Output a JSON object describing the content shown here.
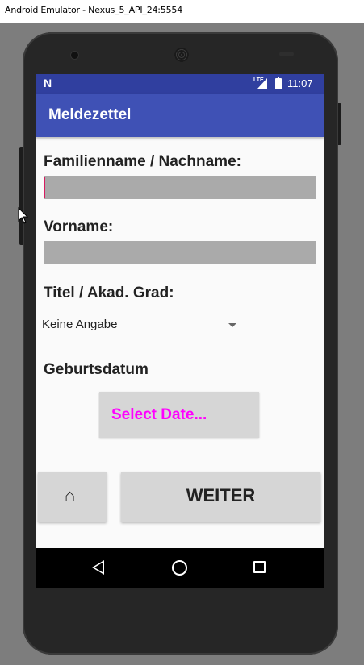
{
  "window": {
    "title": "Android Emulator - Nexus_5_API_24:5554"
  },
  "statusbar": {
    "time": "11:07",
    "network_label": "LTE",
    "notification_icon": "N"
  },
  "appbar": {
    "title": "Meldezettel"
  },
  "form": {
    "surname_label": "Familienname  / Nachname:",
    "surname_value": "",
    "firstname_label": "Vorname:",
    "firstname_value": "",
    "title_label": "Titel / Akad. Grad:",
    "title_selected": "Keine Angabe",
    "birthdate_label": "Geburtsdatum",
    "select_date_button": "Select Date..."
  },
  "buttons": {
    "home_icon": "⌂",
    "next_label": "WEITER"
  },
  "colors": {
    "primary": "#3f51b5",
    "primary_dark": "#303f9f",
    "accent": "#d81b60",
    "date_text": "#ff00ff"
  }
}
